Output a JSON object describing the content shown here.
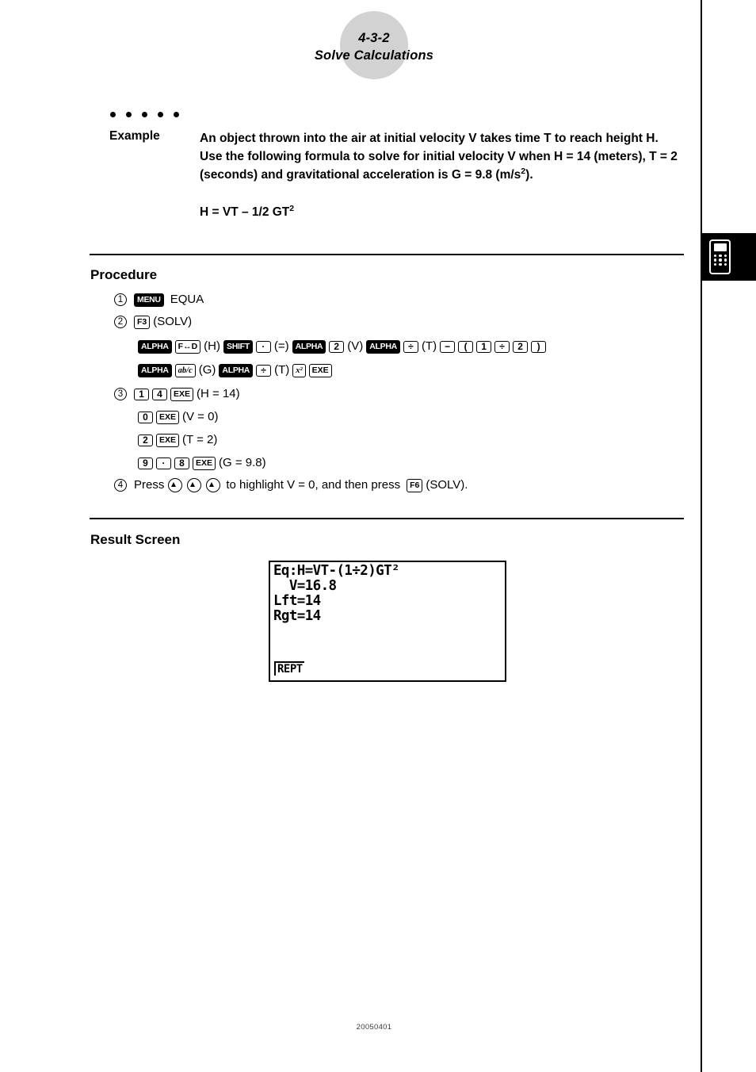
{
  "page": {
    "header_number": "4-3-2",
    "header_title": "Solve Calculations",
    "footer": "20050401"
  },
  "side_tab": {
    "icon": "calculator-icon"
  },
  "example": {
    "label": "Example",
    "body": "An object thrown into the air at initial velocity V takes time T to reach height H. Use the following formula to solve for initial velocity V when H = 14 (meters), T = 2 (seconds) and gravitational acceleration is G = 9.8 (m/s",
    "body_sup": "2",
    "body_tail": ").",
    "formula_main": "H = VT – 1/2 GT",
    "formula_sup": "2"
  },
  "procedure": {
    "title": "Procedure",
    "step1": {
      "number": "1",
      "key_menu": "MENU",
      "text": "EQUA"
    },
    "step2": {
      "number": "2",
      "key_f3": "F3",
      "text_solv": "(SOLV)",
      "line1": {
        "k1": "ALPHA",
        "k2": "F↔D",
        "t2": "(H)",
        "k3": "SHIFT",
        "k4": "·",
        "t4": "(=)",
        "k5": "ALPHA",
        "k6": "2",
        "t6": "(V)",
        "k7": "ALPHA",
        "k8": "÷",
        "t8": "(T)",
        "k9": "−",
        "k10": "(",
        "k11": "1",
        "k12": "÷",
        "k13": "2",
        "k14": ")"
      },
      "line2": {
        "k1": "ALPHA",
        "k2": "ab/c",
        "t2": "(G)",
        "k3": "ALPHA",
        "k4": "÷",
        "t4": "(T)",
        "k5": "x²",
        "k6": "EXE"
      }
    },
    "step3": {
      "number": "3",
      "lines": [
        {
          "keys": [
            "1",
            "4",
            "EXE"
          ],
          "label": "(H = 14)"
        },
        {
          "keys": [
            "0",
            "EXE"
          ],
          "label": "(V = 0)"
        },
        {
          "keys": [
            "2",
            "EXE"
          ],
          "label": "(T = 2)"
        },
        {
          "keys": [
            "9",
            "·",
            "8",
            "EXE"
          ],
          "label": "(G = 9.8)"
        }
      ]
    },
    "step4": {
      "number": "4",
      "text_pre": "Press",
      "arrows": 3,
      "text_mid": "to highlight V = 0, and then press",
      "key_f6": "F6",
      "text_end": "(SOLV)."
    }
  },
  "result": {
    "title": "Result Screen",
    "screen": {
      "line1": "Eq:H=VT-(1÷2)GT²",
      "line2": "  V=16.8",
      "line3": "Lft=14",
      "line4": "Rgt=14",
      "function_key": "REPT"
    }
  }
}
